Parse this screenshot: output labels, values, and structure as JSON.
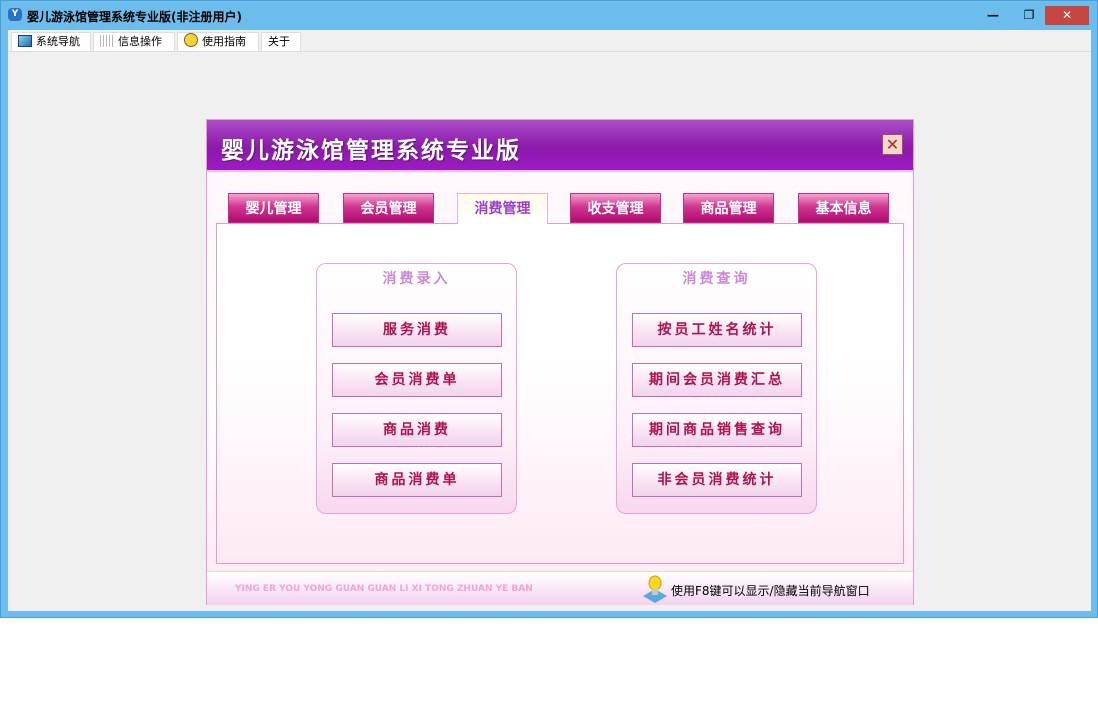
{
  "window": {
    "title": "婴儿游泳馆管理系统专业版(非注册用户)",
    "minimize": "—",
    "restore": "❐",
    "close": "✕"
  },
  "menu": [
    {
      "label": "系统导航",
      "icon": "monitor-icon"
    },
    {
      "label": "信息操作",
      "icon": "grid-icon"
    },
    {
      "label": "使用指南",
      "icon": "help-icon"
    },
    {
      "label": "关于"
    }
  ],
  "dialog": {
    "title": "婴儿游泳馆管理系统专业版",
    "close": "✕",
    "tabs": [
      "婴儿管理",
      "会员管理",
      "消费管理",
      "收支管理",
      "商品管理",
      "基本信息"
    ],
    "active_tab": "消费管理",
    "groups": [
      {
        "title": "消费录入",
        "buttons": [
          "服务消费",
          "会员消费单",
          "商品消费",
          "商品消费单"
        ]
      },
      {
        "title": "消费查询",
        "buttons": [
          "按员工姓名统计",
          "期间会员消费汇总",
          "期间商品销售查询",
          "非会员消费统计"
        ]
      }
    ],
    "footer": {
      "pinyin": "YING ER YOU YONG GUAN GUAN LI XI TONG ZHUAN YE BAN",
      "hint": "使用F8键可以显示/隐藏当前导航窗口"
    }
  },
  "colors": {
    "accent": "#8e19ab",
    "tab": "#c0308a",
    "button_text": "#b0104e"
  }
}
